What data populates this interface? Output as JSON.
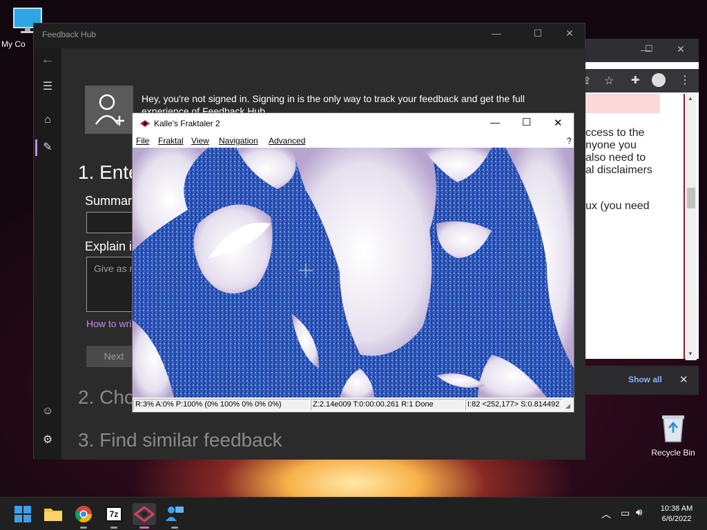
{
  "desktop": {
    "my_computer_label": "My Co",
    "recycle_bin_label": "Recycle Bin"
  },
  "chrome": {
    "lines": [
      "ccess to the",
      "nyone you",
      "also need to",
      "al disclaimers",
      "",
      "ux (you need"
    ],
    "show_all": "Show all",
    "close_glyph": "✕"
  },
  "feedback_hub": {
    "title": "Feedback Hub",
    "signin_message": "Hey, you're not signed in. Signing in is the only way to track your feedback and get the full experience of Feedback Hub.",
    "step1_heading": "1. Ente",
    "summarize_label": "Summari",
    "explain_label": "Explain i",
    "explain_placeholder": "Give as m",
    "how_to_link": "How to wri",
    "next_button": "Next",
    "step2_heading": "2. Cho",
    "step3_heading": "3. Find similar feedback"
  },
  "fraktaler": {
    "title": "Kalle's Fraktaler 2",
    "menu": [
      "File",
      "Fraktal",
      "View",
      "Navigation",
      "Advanced"
    ],
    "help": "?",
    "status": [
      "R:3% A:0% P:100% (0% 100% 0% 0% 0%)",
      "Z:2.14e009 T:0:00:00.261 R:1 Done",
      "I:82 <252,177> S:0.814492"
    ]
  },
  "taskbar": {
    "apps": [
      "Start",
      "File Explorer",
      "Google Chrome",
      "7-Zip",
      "Kalle's Fraktaler 2",
      "Feedback Hub"
    ],
    "seven_zip_label": "7z",
    "time": "10:38 AM",
    "date": "6/6/2022"
  },
  "colors": {
    "fractal_blue": "#2a55b8",
    "fractal_purple": "#3a1a6a",
    "link_purple": "#c58af9"
  }
}
